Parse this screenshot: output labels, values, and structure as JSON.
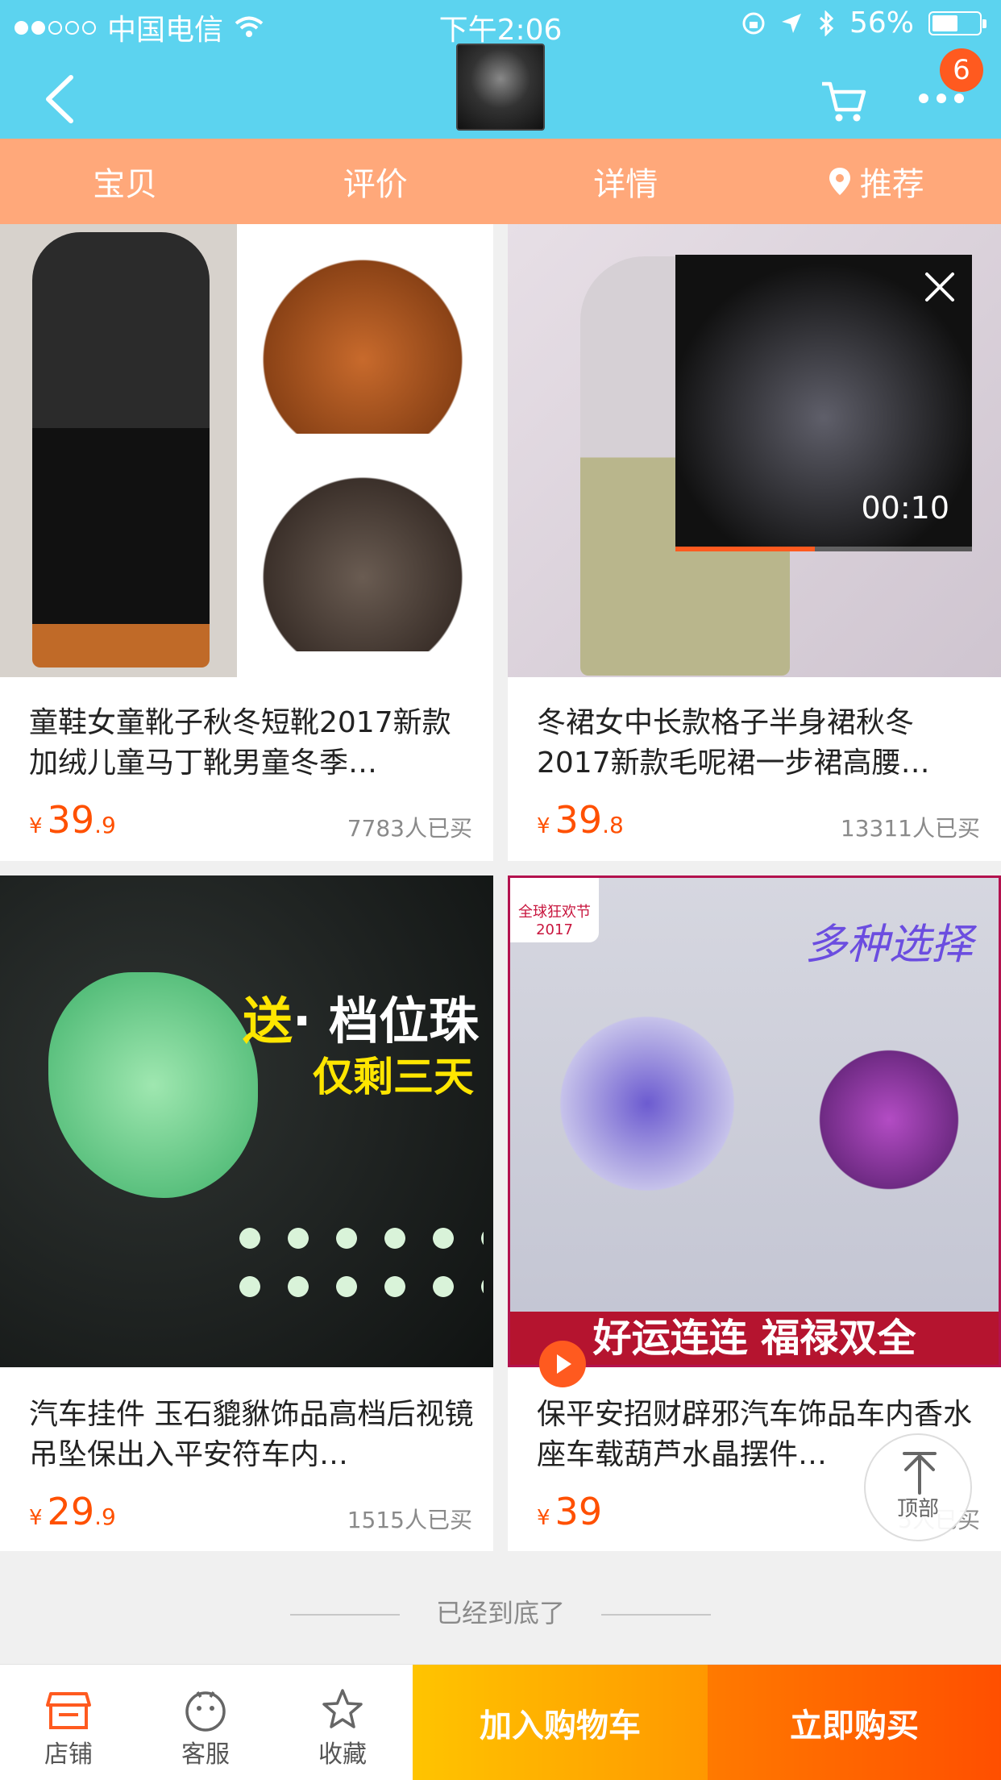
{
  "status_bar": {
    "carrier": "中国电信",
    "time": "下午2:06",
    "battery": "56%",
    "battery_level": 0.56
  },
  "header": {
    "cart_badge": "6",
    "icons": [
      "back-icon",
      "cart-icon",
      "more-icon"
    ]
  },
  "tabs": [
    {
      "label": "宝贝"
    },
    {
      "label": "评价"
    },
    {
      "label": "详情"
    },
    {
      "label": "推荐",
      "icon": "location-pin-icon"
    }
  ],
  "products": [
    {
      "title": "童鞋女童靴子秋冬短靴2017新款加绒儿童马丁靴男童冬季…",
      "currency": "¥",
      "price_int": "39",
      "price_dec": ".9",
      "sold": "7783人已买"
    },
    {
      "title": "冬裙女中长款格子半身裙秋冬2017新款毛呢裙一步裙高腰…",
      "currency": "¥",
      "price_int": "39",
      "price_dec": ".8",
      "sold": "13311人已买"
    },
    {
      "title": "汽车挂件 玉石貔貅饰品高档后视镜吊坠保出入平安符车内…",
      "currency": "¥",
      "price_int": "29",
      "price_dec": ".9",
      "sold": "1515人已买",
      "image_text_1a": "送",
      "image_text_1b": "· 档位珠",
      "image_text_2": "仅剩三天"
    },
    {
      "title": "保平安招财辟邪汽车饰品车内香水座车载葫芦水晶摆件…",
      "currency": "¥",
      "price_int": "39",
      "price_dec": "",
      "sold": "5人已买",
      "image_tag": "全球狂欢节 2017",
      "image_text_top": "多种选择",
      "image_text_bottom": "好运连连 福禄双全"
    }
  ],
  "video": {
    "time": "00:10",
    "progress": 0.47
  },
  "to_top": {
    "label": "顶部"
  },
  "end_text": "已经到底了",
  "bottom_bar": {
    "shop": "店铺",
    "service": "客服",
    "favorite": "收藏",
    "add_to_cart": "加入购物车",
    "buy_now": "立即购买"
  },
  "colors": {
    "header": "#5cd3ef",
    "tabs": "#ffa87a",
    "price": "#ff5000",
    "cart_button": "#ffb300",
    "buy_button": "#ff6a00"
  }
}
